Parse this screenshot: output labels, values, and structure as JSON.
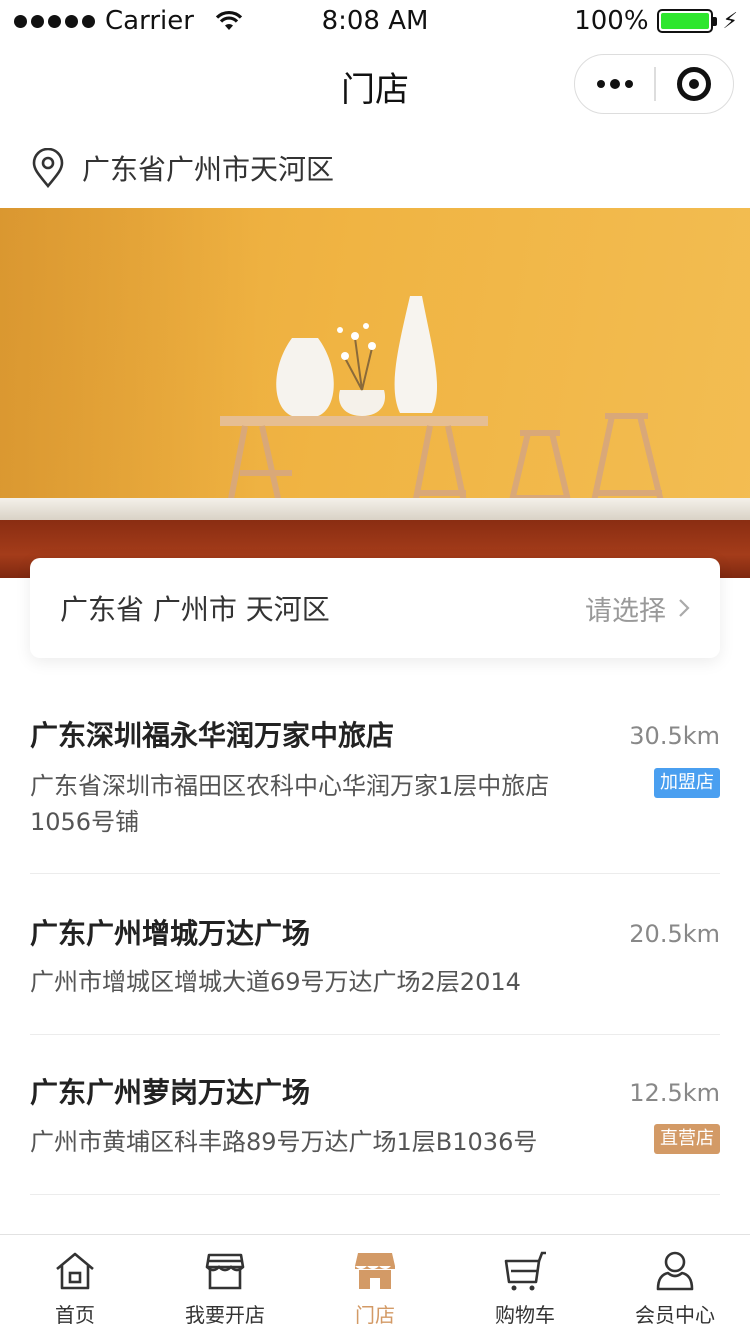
{
  "status_bar": {
    "carrier": "Carrier",
    "time": "8:08 AM",
    "battery": "100%"
  },
  "nav": {
    "title": "门店"
  },
  "location": {
    "current": "广东省广州市天河区"
  },
  "region_selector": {
    "value": "广东省 广州市 天河区",
    "action": "请选择"
  },
  "stores": [
    {
      "name": "广东深圳福永华润万家中旅店",
      "distance": "30.5km",
      "address": "广东省深圳市福田区农科中心华润万家1层中旅店1056号铺",
      "badge": "加盟店"
    },
    {
      "name": "广东广州增城万达广场",
      "distance": "20.5km",
      "address": "广州市增城区增城大道69号万达广场2层2014",
      "badge": ""
    },
    {
      "name": "广东广州萝岗万达广场",
      "distance": "12.5km",
      "address": "广州市黄埔区科丰路89号万达广场1层B1036号",
      "badge": "直营店"
    }
  ],
  "tabs": [
    {
      "label": "首页",
      "icon": "home-icon"
    },
    {
      "label": "我要开店",
      "icon": "shop-open-icon"
    },
    {
      "label": "门店",
      "icon": "store-icon"
    },
    {
      "label": "购物车",
      "icon": "cart-icon"
    },
    {
      "label": "会员中心",
      "icon": "user-icon"
    }
  ],
  "colors": {
    "accent": "#d39a66",
    "join_badge": "#4a9ff0",
    "battery": "#2ee62e"
  }
}
